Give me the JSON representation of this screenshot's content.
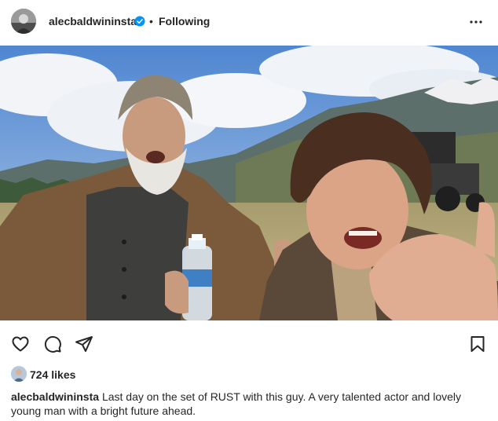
{
  "header": {
    "username": "alecbaldwininsta",
    "separator": "•",
    "follow_label": "Following"
  },
  "icons": {
    "avatar": "profile-avatar",
    "verified": "verified-badge-icon",
    "more": "more-options-icon",
    "like": "heart-icon",
    "comment": "comment-icon",
    "share": "share-icon",
    "save": "bookmark-icon"
  },
  "likes": {
    "count_label": "724 likes"
  },
  "caption": {
    "username": "alecbaldwininsta",
    "text": "Last day on the set of RUST with this guy. A very talented actor and lovely young man with a bright future ahead."
  },
  "colors": {
    "text": "#262626",
    "verified": "#0095f6",
    "sky": "#87aee0"
  }
}
